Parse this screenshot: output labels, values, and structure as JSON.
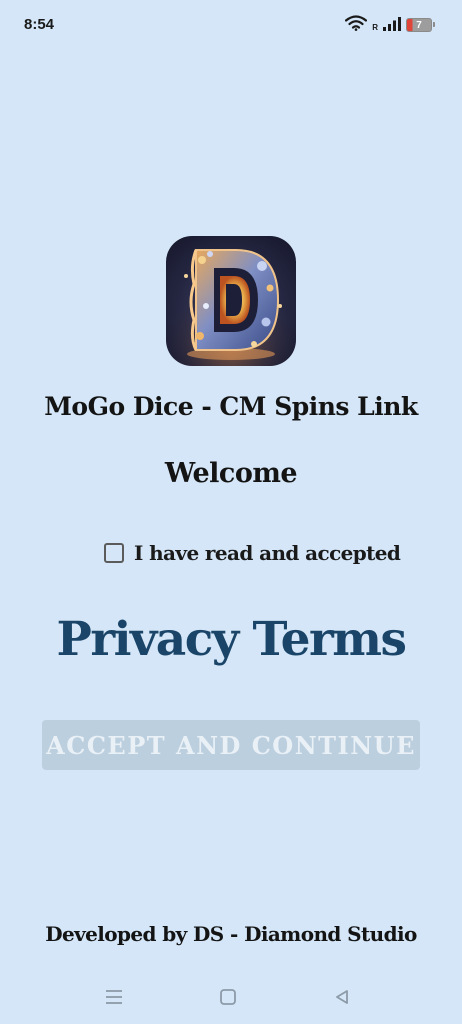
{
  "status_bar": {
    "time": "8:54",
    "roaming": "R",
    "battery": "7",
    "icons": [
      "wifi-icon",
      "signal-icon",
      "battery-icon"
    ]
  },
  "app": {
    "icon": "dice-d-logo",
    "title": "MoGo Dice - CM Spins Link",
    "welcome": "Welcome"
  },
  "consent": {
    "checkbox_label": "I have read and accepted",
    "checked": false,
    "privacy_link": "Privacy Terms",
    "accept_button": "ACCEPT AND CONTINUE"
  },
  "footer": {
    "developer": "Developed by DS - Diamond Studio"
  },
  "nav_bar": {
    "icons": [
      "menu-icon",
      "home-icon",
      "back-icon"
    ]
  },
  "colors": {
    "background": "#d4e6f7",
    "link": "#1a4568",
    "button_disabled": "#bccfdf",
    "battery_low": "#e0453a"
  }
}
